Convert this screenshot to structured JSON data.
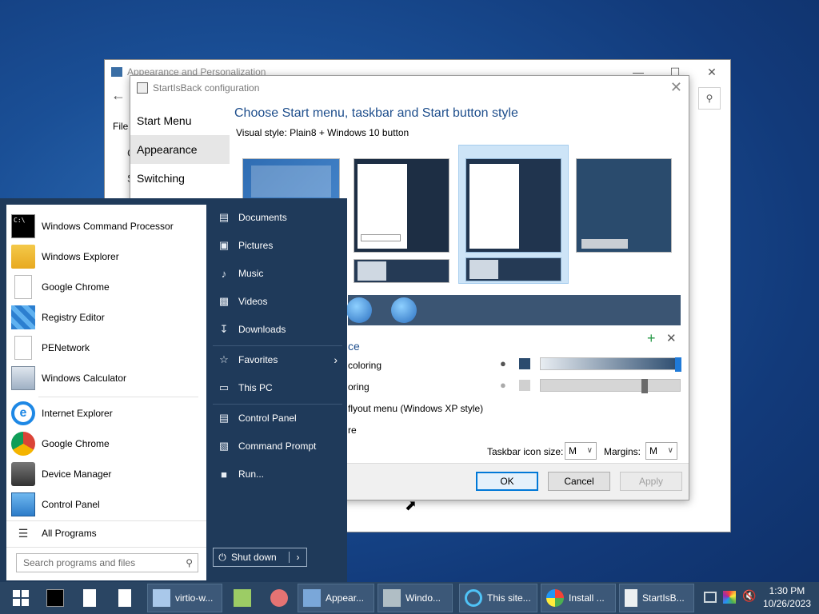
{
  "background_window": {
    "title": "Appearance and Personalization",
    "back_icon": "back-arrow-icon",
    "file_label": "File",
    "side_letters": [
      "C",
      "S"
    ]
  },
  "dialog": {
    "title": "StartIsBack configuration",
    "nav": [
      {
        "label": "Start Menu"
      },
      {
        "label": "Appearance"
      },
      {
        "label": "Switching"
      }
    ],
    "heading": "Choose Start menu, taskbar and Start button style",
    "visual_style": "Visual style:  Plain8 + Windows 10 button",
    "options": [
      {
        "label": "ce"
      },
      {
        "label": "coloring"
      },
      {
        "label": "oring"
      },
      {
        "label": "flyout menu (Windows XP style)"
      },
      {
        "label": "re"
      }
    ],
    "taskbar_icon_size_label": "Taskbar icon size:",
    "taskbar_icon_size_value": "M",
    "margins_label": "Margins:",
    "margins_value": "M",
    "ok_label": "OK",
    "cancel_label": "Cancel",
    "apply_label": "Apply",
    "slider1_level": 1.0,
    "slider2_level": 0.75,
    "swatch1_color": "#2b4b6e",
    "swatch2_color": "#d0d0d0"
  },
  "start_menu": {
    "left_items": [
      {
        "label": "Windows Command Processor",
        "icon": "cmd-icon"
      },
      {
        "label": "Windows Explorer",
        "icon": "folder-icon"
      },
      {
        "label": "Google Chrome",
        "icon": "blank-file-icon"
      },
      {
        "label": "Registry Editor",
        "icon": "registry-icon"
      },
      {
        "label": "PENetwork",
        "icon": "blank-file-icon"
      },
      {
        "label": "Windows Calculator",
        "icon": "calculator-icon"
      },
      {
        "label": "Internet Explorer",
        "icon": "ie-icon"
      },
      {
        "label": "Google Chrome",
        "icon": "chrome-icon"
      },
      {
        "label": "Device Manager",
        "icon": "device-manager-icon"
      },
      {
        "label": "Control Panel",
        "icon": "control-panel-icon"
      }
    ],
    "all_programs": "All Programs",
    "search_placeholder": "Search programs and files",
    "right_items": [
      {
        "label": "Documents",
        "icon": "documents-icon"
      },
      {
        "label": "Pictures",
        "icon": "pictures-icon"
      },
      {
        "label": "Music",
        "icon": "music-icon"
      },
      {
        "label": "Videos",
        "icon": "videos-icon"
      },
      {
        "label": "Downloads",
        "icon": "downloads-icon"
      },
      {
        "label": "Favorites",
        "icon": "star-icon"
      },
      {
        "label": "This PC",
        "icon": "computer-icon"
      },
      {
        "label": "Control Panel",
        "icon": "control-panel-icon"
      },
      {
        "label": "Command Prompt",
        "icon": "cmd-icon"
      },
      {
        "label": "Run...",
        "icon": "run-icon"
      }
    ],
    "shutdown_label": "Shut down"
  },
  "taskbar": {
    "buttons": [
      {
        "label": "virtio-w...",
        "icon": "document-icon"
      },
      {
        "label": "Appear...",
        "icon": "appearance-icon"
      },
      {
        "label": "Windo...",
        "icon": "computer-icon"
      },
      {
        "label": "This site...",
        "icon": "ie-icon"
      },
      {
        "label": "Install ...",
        "icon": "windows-flag-icon"
      },
      {
        "label": "StartIsB...",
        "icon": "startisback-icon"
      }
    ],
    "time": "1:30 PM",
    "date": "10/26/2023"
  }
}
